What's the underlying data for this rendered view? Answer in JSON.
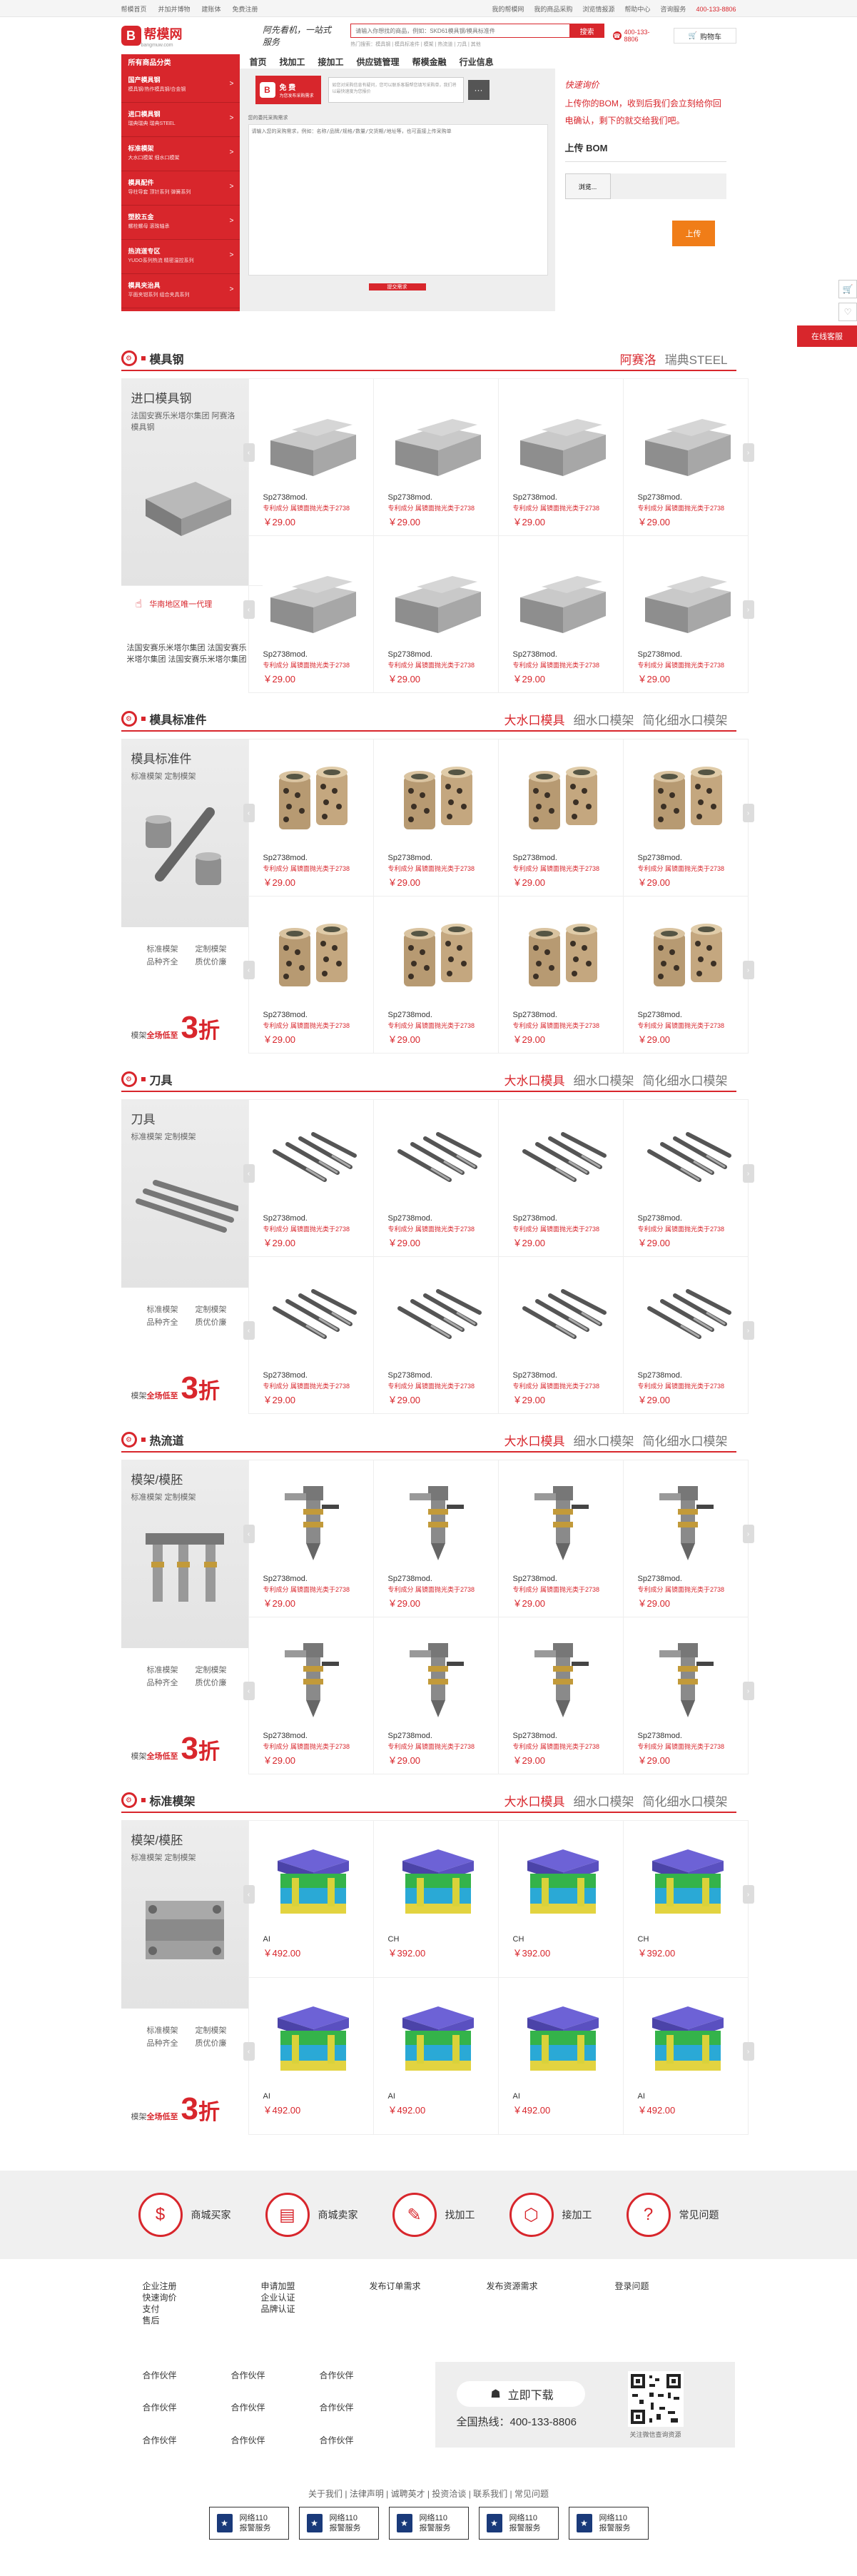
{
  "topbar": {
    "left": [
      "帮模首页",
      "并加并博物",
      "建账体",
      "免费注册"
    ],
    "right": [
      "我的帮模网",
      "我的商品采购",
      "浏览情报源",
      "帮助中心",
      "咨询服务"
    ],
    "phone": "400-133-8806"
  },
  "header": {
    "logo": "帮模网",
    "logo_sub": "bangmuw.com",
    "slogan": "阿先看机，一站式服务",
    "search_placeholder": "请输入你想找的商品，例如：SKD61模具钢/模具标准件",
    "search_btn": "搜索",
    "hot": "热门搜索：模具钢 | 模具标准件 | 模架 | 热流道 | 刀具 | 其他",
    "hotline": "400-133-8806",
    "cart": "购物车"
  },
  "nav": {
    "allcat": "所有商品分类",
    "items": [
      "首页",
      "找加工",
      "接加工",
      "供应链管理",
      "帮模金融",
      "行业信息"
    ]
  },
  "categories": [
    {
      "t": "国产模具钢",
      "d": "模具钢/热作模具钢/合金钢"
    },
    {
      "t": "进口模具钢",
      "d": "瑞典瑞典 瑞典STEEL"
    },
    {
      "t": "标准模架",
      "d": "大水口模架 细水口模架"
    },
    {
      "t": "模具配件",
      "d": "导柱导套 顶针系列 弹簧系列"
    },
    {
      "t": "塑胶五金",
      "d": "螺栓螺母 滚珠轴承"
    },
    {
      "t": "热流道专区",
      "d": "YUDO系列热流 精密温控系列"
    },
    {
      "t": "模具夹治具",
      "d": "平面夹钳系列 组合夹具系列"
    }
  ],
  "form": {
    "free_w": "免 费",
    "free_s": "为您发布采购需求",
    "tip": "如您对采购信息有疑问，您可以联系客服帮您填写采购单，我们将以最快速度为您报价",
    "label": "您的委托采购需求",
    "placeholder": "请输入您的采购需求，例如：名称/品牌/规格/数量/交货期/地址等，也可直接上传采购单",
    "submit": "提交需求"
  },
  "bom": {
    "h": "快速询价",
    "p": "上传你的BOM，收到后我们会立刻给你回电确认，剩下的就交给我们吧。",
    "u": "上传 BOM",
    "browse": "浏览...",
    "upload": "上传"
  },
  "side": {
    "svc": "在线客服"
  },
  "floors": [
    {
      "title": "模具钢",
      "tabs": [
        "阿赛洛",
        "瑞典STEEL"
      ],
      "type": "steel",
      "promo": {
        "title": "进口模具钢",
        "desc": "法国安赛乐米塔尔集团 阿赛洛模具钢",
        "agent": "华南地区唯一代理",
        "btxt": "法国安赛乐米塔尔集团 法国安赛乐米塔尔集团 法国安赛乐米塔尔集团"
      },
      "products": [
        {
          "n": "Sp2738mod.",
          "d": "专利成分 属镜面抛光类于2738",
          "p": "￥29.00"
        },
        {
          "n": "Sp2738mod.",
          "d": "专利成分 属镜面抛光类于2738",
          "p": "￥29.00"
        },
        {
          "n": "Sp2738mod.",
          "d": "专利成分 属镜面抛光类于2738",
          "p": "￥29.00"
        },
        {
          "n": "Sp2738mod.",
          "d": "专利成分 属镜面抛光类于2738",
          "p": "￥29.00"
        },
        {
          "n": "Sp2738mod.",
          "d": "专利成分 属镜面抛光类于2738",
          "p": "￥29.00"
        },
        {
          "n": "Sp2738mod.",
          "d": "专利成分 属镜面抛光类于2738",
          "p": "￥29.00"
        },
        {
          "n": "Sp2738mod.",
          "d": "专利成分 属镜面抛光类于2738",
          "p": "￥29.00"
        },
        {
          "n": "Sp2738mod.",
          "d": "专利成分 属镜面抛光类于2738",
          "p": "￥29.00"
        }
      ]
    },
    {
      "title": "模具标准件",
      "tabs": [
        "大水口模具",
        "细水口模架",
        "简化细水口模架"
      ],
      "type": "bushing",
      "promo": {
        "title": "模具标准件",
        "desc": "标准模架 定制模架",
        "b1": "标准模架",
        "b2": "定制模架",
        "b3": "品种齐全",
        "b4": "质优价廉",
        "pre": "模架",
        "pre2": "全场低至",
        "num": "3",
        "zhe": "折"
      },
      "products": [
        {
          "n": "Sp2738mod.",
          "d": "专利成分 属镜面抛光类于2738",
          "p": "￥29.00"
        },
        {
          "n": "Sp2738mod.",
          "d": "专利成分 属镜面抛光类于2738",
          "p": "￥29.00"
        },
        {
          "n": "Sp2738mod.",
          "d": "专利成分 属镜面抛光类于2738",
          "p": "￥29.00"
        },
        {
          "n": "Sp2738mod.",
          "d": "专利成分 属镜面抛光类于2738",
          "p": "￥29.00"
        },
        {
          "n": "Sp2738mod.",
          "d": "专利成分 属镜面抛光类于2738",
          "p": "￥29.00"
        },
        {
          "n": "Sp2738mod.",
          "d": "专利成分 属镜面抛光类于2738",
          "p": "￥29.00"
        },
        {
          "n": "Sp2738mod.",
          "d": "专利成分 属镜面抛光类于2738",
          "p": "￥29.00"
        },
        {
          "n": "Sp2738mod.",
          "d": "专利成分 属镜面抛光类于2738",
          "p": "￥29.00"
        }
      ]
    },
    {
      "title": "刀具",
      "tabs": [
        "大水口模具",
        "细水口模架",
        "简化细水口模架"
      ],
      "type": "tool",
      "promo": {
        "title": "刀具",
        "desc": "标准模架 定制模架",
        "b1": "标准模架",
        "b2": "定制模架",
        "b3": "品种齐全",
        "b4": "质优价廉",
        "pre": "模架",
        "pre2": "全场低至",
        "num": "3",
        "zhe": "折"
      },
      "products": [
        {
          "n": "Sp2738mod.",
          "d": "专利成分 属镜面抛光类于2738",
          "p": "￥29.00"
        },
        {
          "n": "Sp2738mod.",
          "d": "专利成分 属镜面抛光类于2738",
          "p": "￥29.00"
        },
        {
          "n": "Sp2738mod.",
          "d": "专利成分 属镜面抛光类于2738",
          "p": "￥29.00"
        },
        {
          "n": "Sp2738mod.",
          "d": "专利成分 属镜面抛光类于2738",
          "p": "￥29.00"
        },
        {
          "n": "Sp2738mod.",
          "d": "专利成分 属镜面抛光类于2738",
          "p": "￥29.00"
        },
        {
          "n": "Sp2738mod.",
          "d": "专利成分 属镜面抛光类于2738",
          "p": "￥29.00"
        },
        {
          "n": "Sp2738mod.",
          "d": "专利成分 属镜面抛光类于2738",
          "p": "￥29.00"
        },
        {
          "n": "Sp2738mod.",
          "d": "专利成分 属镜面抛光类于2738",
          "p": "￥29.00"
        }
      ]
    },
    {
      "title": "热流道",
      "tabs": [
        "大水口模具",
        "细水口模架",
        "简化细水口模架"
      ],
      "type": "nozzle",
      "promo": {
        "title": "模架/模胚",
        "desc": "标准模架 定制模架",
        "b1": "标准模架",
        "b2": "定制模架",
        "b3": "品种齐全",
        "b4": "质优价廉",
        "pre": "模架",
        "pre2": "全场低至",
        "num": "3",
        "zhe": "折"
      },
      "products": [
        {
          "n": "Sp2738mod.",
          "d": "专利成分 属镜面抛光类于2738",
          "p": "￥29.00"
        },
        {
          "n": "Sp2738mod.",
          "d": "专利成分 属镜面抛光类于2738",
          "p": "￥29.00"
        },
        {
          "n": "Sp2738mod.",
          "d": "专利成分 属镜面抛光类于2738",
          "p": "￥29.00"
        },
        {
          "n": "Sp2738mod.",
          "d": "专利成分 属镜面抛光类于2738",
          "p": "￥29.00"
        },
        {
          "n": "Sp2738mod.",
          "d": "专利成分 属镜面抛光类于2738",
          "p": "￥29.00"
        },
        {
          "n": "Sp2738mod.",
          "d": "专利成分 属镜面抛光类于2738",
          "p": "￥29.00"
        },
        {
          "n": "Sp2738mod.",
          "d": "专利成分 属镜面抛光类于2738",
          "p": "￥29.00"
        },
        {
          "n": "Sp2738mod.",
          "d": "专利成分 属镜面抛光类于2738",
          "p": "￥29.00"
        }
      ]
    },
    {
      "title": "标准模架",
      "tabs": [
        "大水口模具",
        "细水口模架",
        "简化细水口模架"
      ],
      "type": "moldbase",
      "promo": {
        "title": "模架/模胚",
        "desc": "标准模架 定制模架",
        "b1": "标准模架",
        "b2": "定制模架",
        "b3": "品种齐全",
        "b4": "质优价廉",
        "pre": "模架",
        "pre2": "全场低至",
        "num": "3",
        "zhe": "折"
      },
      "products": [
        {
          "n": "AI",
          "d": "",
          "p": "￥492.00"
        },
        {
          "n": "CH",
          "d": "",
          "p": "￥392.00"
        },
        {
          "n": "CH",
          "d": "",
          "p": "￥392.00"
        },
        {
          "n": "CH",
          "d": "",
          "p": "￥392.00"
        },
        {
          "n": "AI",
          "d": "",
          "p": "￥492.00"
        },
        {
          "n": "AI",
          "d": "",
          "p": "￥492.00"
        },
        {
          "n": "AI",
          "d": "",
          "p": "￥492.00"
        },
        {
          "n": "AI",
          "d": "",
          "p": "￥492.00"
        }
      ]
    }
  ],
  "footer": {
    "features": [
      {
        "i": "$",
        "t": "商城买家"
      },
      {
        "i": "▤",
        "t": "商城卖家"
      },
      {
        "i": "✎",
        "t": "找加工"
      },
      {
        "i": "⬡",
        "t": "接加工"
      },
      {
        "i": "?",
        "t": "常见问题"
      }
    ],
    "links": [
      [
        "企业注册",
        "快速询价",
        "支付",
        "售后"
      ],
      [
        "申请加盟",
        "企业认证",
        "品牌认证"
      ],
      [
        "发布订单需求"
      ],
      [
        "发布资源需求"
      ],
      [
        "登录问题"
      ]
    ],
    "partners": [
      "合作伙伴",
      "合作伙伴",
      "合作伙伴",
      "合作伙伴",
      "合作伙伴",
      "合作伙伴",
      "合作伙伴",
      "合作伙伴",
      "合作伙伴"
    ],
    "app": {
      "btn": "立即下载",
      "hot": "全国热线：400-133-8806",
      "qr": "关注微信查询资源"
    },
    "bottom": "关于我们 | 法律声明 | 诚聘英才 | 投资洽谈 | 联系我们 | 常见问题",
    "badges": [
      {
        "a": "网络110",
        "b": "报警服务"
      },
      {
        "a": "网络110",
        "b": "报警服务"
      },
      {
        "a": "网络110",
        "b": "报警服务"
      },
      {
        "a": "网络110",
        "b": "报警服务"
      },
      {
        "a": "网络110",
        "b": "报警服务"
      }
    ]
  }
}
